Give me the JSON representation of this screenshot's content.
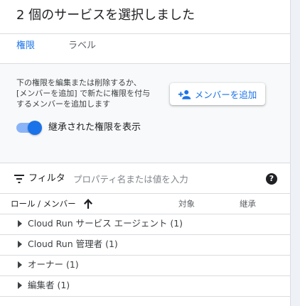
{
  "title": "2 個のサービスを選択しました",
  "tabs": [
    {
      "label": "権限",
      "active": true
    },
    {
      "label": "ラベル",
      "active": false
    }
  ],
  "description_lines": [
    "下の権限を編集または削除するか、",
    "[メンバーを追加] で新たに権限を付与",
    "するメンバーを追加します"
  ],
  "add_member_button": {
    "label": "メンバーを追加",
    "icon": "person-add-icon"
  },
  "inherited_toggle": {
    "label": "継承された権限を表示",
    "on": true
  },
  "filter": {
    "label": "フィルタ",
    "placeholder": "プロパティ名または値を入力"
  },
  "table": {
    "headers": {
      "role": "ロール / メンバー",
      "target": "対象",
      "inherited": "継承"
    },
    "rows": [
      {
        "label": "Cloud Run サービス エージェント (1)"
      },
      {
        "label": "Cloud Run 管理者 (1)"
      },
      {
        "label": "オーナー (1)"
      },
      {
        "label": "編集者 (1)"
      }
    ]
  },
  "colors": {
    "accent": "#1a73e8",
    "divider": "#dadce0"
  }
}
